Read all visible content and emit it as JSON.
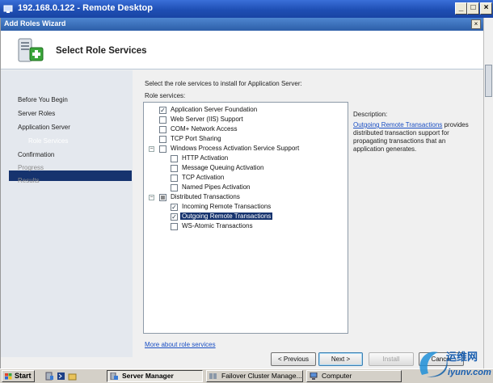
{
  "rdp": {
    "title": "192.168.0.122 - Remote Desktop",
    "buttons": [
      "_",
      "□",
      "×"
    ]
  },
  "wizard": {
    "title": "Add Roles Wizard",
    "close": "×",
    "header_title": "Select Role Services"
  },
  "nav": {
    "items": [
      {
        "label": "Before You Begin",
        "state": "normal"
      },
      {
        "label": "Server Roles",
        "state": "normal"
      },
      {
        "label": "Application Server",
        "state": "normal"
      },
      {
        "label": "Role Services",
        "state": "selected"
      },
      {
        "label": "Confirmation",
        "state": "normal"
      },
      {
        "label": "Progress",
        "state": "disabled"
      },
      {
        "label": "Results",
        "state": "disabled"
      }
    ]
  },
  "content": {
    "intro": "Select the role services to install for Application Server:",
    "role_services_label": "Role services:",
    "tree": [
      {
        "label": "Application Server Foundation",
        "check": "checked",
        "level": 0
      },
      {
        "label": "Web Server (IIS) Support",
        "check": "unchecked",
        "level": 0
      },
      {
        "label": "COM+ Network Access",
        "check": "unchecked",
        "level": 0
      },
      {
        "label": "TCP Port Sharing",
        "check": "unchecked",
        "level": 0
      },
      {
        "label": "Windows Process Activation Service Support",
        "check": "unchecked",
        "level": 0,
        "expander": "−"
      },
      {
        "label": "HTTP Activation",
        "check": "unchecked",
        "level": 1
      },
      {
        "label": "Message Queuing Activation",
        "check": "unchecked",
        "level": 1
      },
      {
        "label": "TCP Activation",
        "check": "unchecked",
        "level": 1
      },
      {
        "label": "Named Pipes Activation",
        "check": "unchecked",
        "level": 1
      },
      {
        "label": "Distributed Transactions",
        "check": "partial",
        "level": 0,
        "expander": "−"
      },
      {
        "label": "Incoming Remote Transactions",
        "check": "checked",
        "level": 1
      },
      {
        "label": "Outgoing Remote Transactions",
        "check": "checked",
        "level": 1,
        "selected": true
      },
      {
        "label": "WS-Atomic Transactions",
        "check": "unchecked",
        "level": 1
      }
    ],
    "more_link": "More about role services",
    "description_label": "Description:",
    "description_link": "Outgoing Remote Transactions",
    "description_text": " provides distributed transaction support for propagating transactions that an application generates."
  },
  "buttons": {
    "previous": "< Previous",
    "next": "Next >",
    "install": "Install",
    "cancel": "Cancel"
  },
  "taskbar": {
    "start": "Start",
    "tasks": [
      {
        "label": "Server Manager",
        "active": true
      },
      {
        "label": "Failover Cluster Manage...",
        "active": false
      },
      {
        "label": "Computer",
        "active": false
      }
    ]
  },
  "watermark": {
    "text": "运维网",
    "url": "iyunv.com"
  },
  "colors": {
    "selection": "#16336e",
    "link": "#1a4fc4",
    "nav_bg": "#e4e8ee",
    "title_bar": "#1f4fb4"
  }
}
